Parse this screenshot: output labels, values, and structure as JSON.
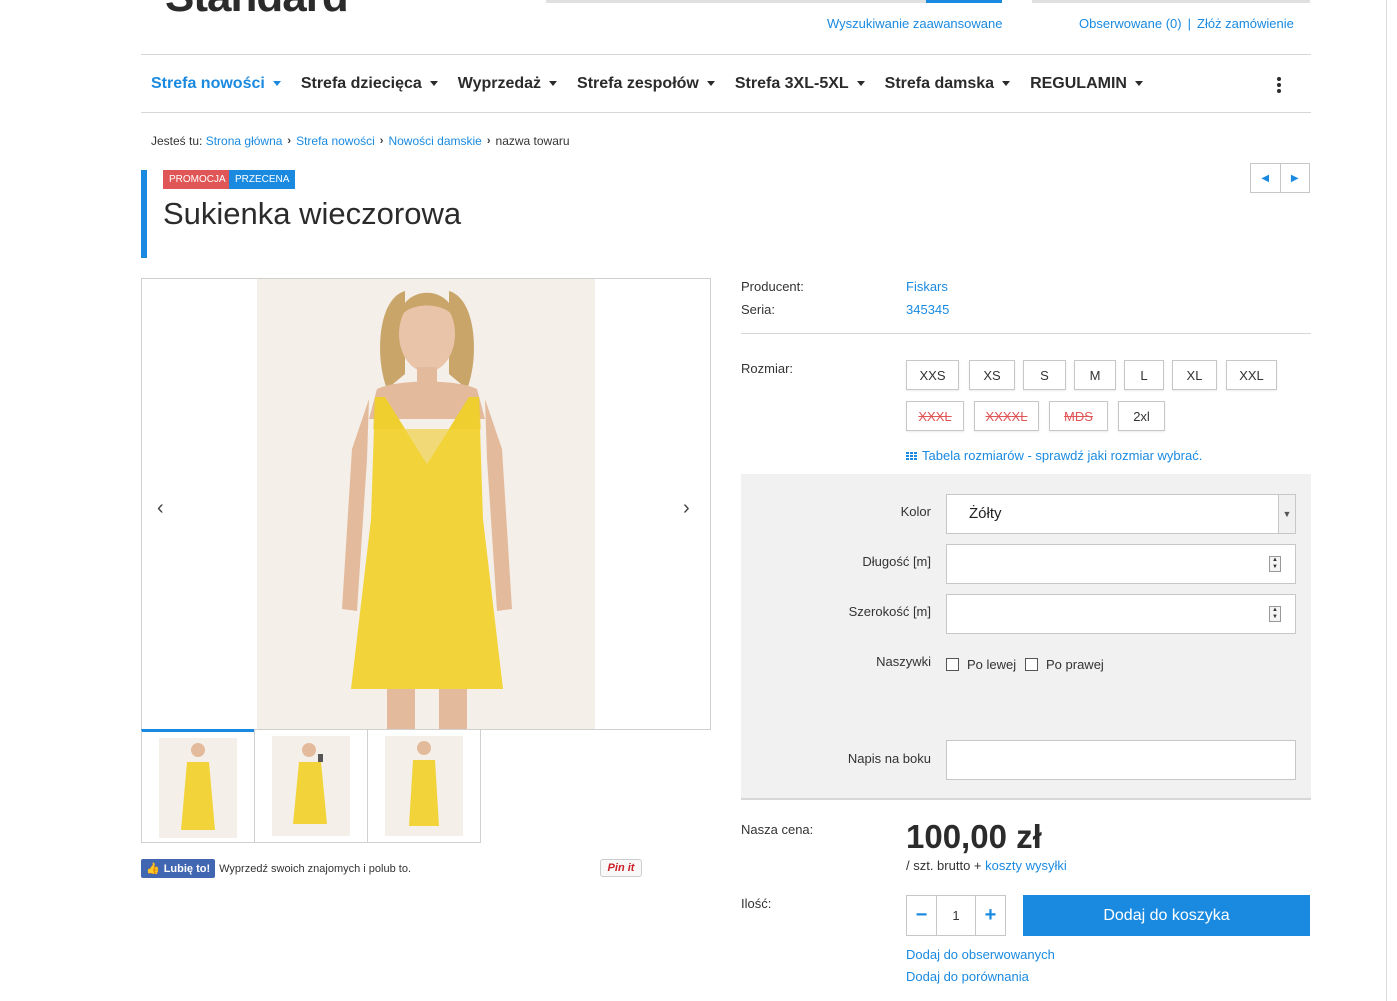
{
  "header": {
    "logo_text": "Standard",
    "advanced_search": "Wyszukiwanie zaawansowane",
    "observed": "Obserwowane (0)",
    "separator": "|",
    "place_order": "Złóż zamówienie"
  },
  "menu": {
    "items": [
      {
        "label": "Strefa nowości"
      },
      {
        "label": "Strefa dziecięca"
      },
      {
        "label": "Wyprzedaż"
      },
      {
        "label": "Strefa zespołów"
      },
      {
        "label": "Strefa 3XL-5XL"
      },
      {
        "label": "Strefa damska"
      },
      {
        "label": "REGULAMIN"
      }
    ]
  },
  "breadcrumb": {
    "prefix": "Jesteś tu:",
    "items": [
      "Strona główna",
      "Strefa nowości",
      "Nowości damskie"
    ],
    "current": "nazwa towaru"
  },
  "product": {
    "badge_promo": "PROMOCJA",
    "badge_sale": "PRZECENA",
    "title": "Sukienka wieczorowa"
  },
  "gallery": {
    "prev": "‹",
    "next": "›",
    "main_image_alt": "Yellow slip dress - front",
    "thumbs": [
      "front",
      "side",
      "pose"
    ]
  },
  "social": {
    "like_label": "Lubię to!",
    "like_text": "Wyprzedź swoich znajomych i polub to.",
    "pin_label": "Pin it"
  },
  "details": {
    "producer_label": "Producent:",
    "producer_value": "Fiskars",
    "series_label": "Seria:",
    "series_value": "345345",
    "size_label": "Rozmiar:",
    "sizes_row1": [
      "XXS",
      "XS",
      "S",
      "M",
      "L",
      "XL",
      "XXL"
    ],
    "sizes_row2": [
      "XXXL",
      "XXXXL",
      "MDS",
      "2xl"
    ],
    "size_table_link": "Tabela rozmiarów - sprawdź jaki rozmiar wybrać."
  },
  "options": {
    "color_label": "Kolor",
    "color_value": "Żółty",
    "length_label": "Długość [m]",
    "width_label": "Szerokość [m]",
    "patches_label": "Naszywki",
    "patch_left": "Po lewej",
    "patch_right": "Po prawej",
    "side_text_label": "Napis na boku"
  },
  "purchase": {
    "price_label": "Nasza cena:",
    "price": "100,00 zł",
    "price_unit": "/ szt. brutto +",
    "shipping_link": "koszty wysyłki",
    "qty_label": "Ilość:",
    "qty_value": "1",
    "minus": "−",
    "plus": "+",
    "add_to_cart": "Dodaj do koszyka",
    "add_to_observed": "Dodaj do obserwowanych",
    "add_to_compare": "Dodaj do porównania"
  },
  "colors": {
    "accent": "#1a8ae0",
    "promo_badge": "#e05555",
    "dress_yellow": "#f2d43a"
  }
}
